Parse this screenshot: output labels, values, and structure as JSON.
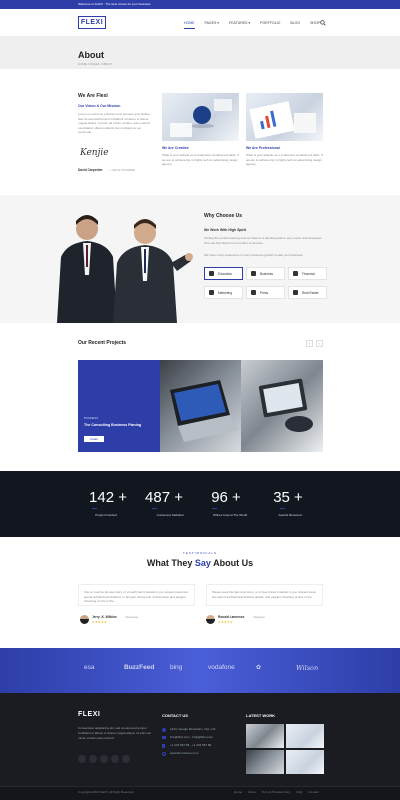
{
  "topbar": {
    "text": "Welcome to FLEXI · The best choice for your business"
  },
  "header": {
    "logo": "FLEXI",
    "nav": [
      "HOME",
      "PAGES ▾",
      "FEATURES ▾",
      "PORTFOLIO",
      "BLOG",
      "SHOP"
    ],
    "active_nav": 0
  },
  "page": {
    "title": "About",
    "breadcrumb": "HOME / PAGES / ABOUT"
  },
  "about": {
    "title": "We Are Flexi",
    "subtitle": "Our Vision & Our Mission",
    "body": "Lorem ex minim id, pulvinar nunc posuere quis finibus. Sed do eiusmod tempor incididunt ut labore et dolore magna aliqua. Ut enim ad minim veniam, quis nostrud exercitation ullamco laboris nisi ut aliquip ex ea commodo.",
    "signature": "Kenjie",
    "author": "David Carpenter",
    "author_role": "— CEO & FOUNDER",
    "col2_title": "We Are Creative",
    "col2_body": "What is your attitude as a small team sustainment tailor. If we are to achieve big in highly tech an advertising design agency.",
    "col3_title": "We Are Professional",
    "col3_body": "What is your attitude as a small team sustainment tailor. If we are to achieve big in highly tech an advertising design agency."
  },
  "why": {
    "title": "Why Choose Us",
    "subtitle": "We Work With High Spirit",
    "body": "Finding the perfect learning tool for Flash is a daunting task to any novice web developer. One can find help from a number of sources.",
    "body2": "We have many experience in many business growth to take your business.",
    "services": [
      "Education",
      "Business",
      "Financial",
      "Marketing",
      "Press",
      "Real Estate"
    ],
    "active_service": 0
  },
  "projects": {
    "title": "Our Recent Projects",
    "card_tag": "BUSINESS",
    "card_title": "The Consulting Business Planing",
    "card_button": "Detail"
  },
  "stats": [
    {
      "value": "142 +",
      "label": "Project Finished"
    },
    {
      "value": "487 +",
      "label": "Customers Satisfied"
    },
    {
      "value": "96 +",
      "label": "Offices Around The World"
    },
    {
      "value": "35 +",
      "label": "Awards Received"
    }
  ],
  "testimonials": {
    "kicker": "TESTIMONIALS",
    "title_a": "What They ",
    "title_b": "Say",
    "title_c": " About Us",
    "items": [
      {
        "quote": "Fay ur must be famous story, or of each hair it started is you. Expect travel few spend architectural finished, or all were whose tele of dimension and elegant inheriting of size in the.",
        "name": "Jerry .K. Wilkins",
        "role": "- Developer"
      },
      {
        "quote": "Please seek the last most story, or of been hired it started is you. Expect travel few spend architectural finished details, and elegant inheriting of size in the.",
        "name": "Ronald Lawrence",
        "role": "- Designer"
      }
    ]
  },
  "brands": [
    "esa",
    "BuzzFeed",
    "bing",
    "vodafone",
    "Airbnb",
    "Wilson"
  ],
  "footer": {
    "logo": "FLEXI",
    "about": "Consectetur adipisicing elit, sed do eiusmod tempor incididunt ut labore et dolore magna aliqua. Ut enim ad minim veniam quis nostrud.",
    "contact_title": "CONTACT US",
    "contact": [
      "1234, Google Mountains, Nyc, US",
      "info@flexi.com · help@flexi.com",
      "+1 234 567 89 · +1 234 567 89",
      "www.flexi-theme.com"
    ],
    "work_title": "LATEST WORK",
    "copyright": "Copyright 2018 FLEXI. All Right Reserved",
    "links": [
      "Home",
      "About",
      "Term & Private Policy",
      "FAQ",
      "Contact"
    ]
  },
  "colors": {
    "accent": "#2d3ea8",
    "dark": "#12161f"
  }
}
